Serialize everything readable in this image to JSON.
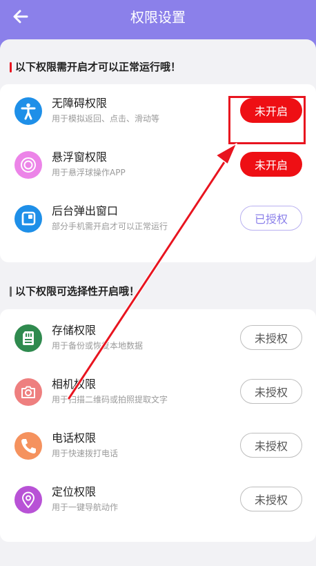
{
  "header": {
    "title": "权限设置",
    "back_icon": "arrow-left-icon",
    "background": "#8b80ea"
  },
  "sections": [
    {
      "title": "以下权限需开启才可以正常运行哦！",
      "accent": "#e8141f",
      "items": [
        {
          "name": "无障碍权限",
          "desc": "用于模拟返回、点击、滑动等",
          "button": "未开启",
          "icon": "accessibility-icon",
          "icon_color": "#1e8fe8"
        },
        {
          "name": "悬浮窗权限",
          "desc": "用于悬浮球操作APP",
          "button": "未开启",
          "icon": "floating-ball-icon",
          "icon_color": "#ec84e8"
        },
        {
          "name": "后台弹出窗口",
          "desc": "部分手机需开启才可以正常运行",
          "button": "已授权",
          "icon": "popup-window-icon",
          "icon_color": "#1e8fe8"
        }
      ]
    },
    {
      "title": "以下权限可选择性开启哦！",
      "accent": "#6b6b6b",
      "items": [
        {
          "name": "存储权限",
          "desc": "用于备份或恢复本地数据",
          "button": "未授权",
          "icon": "sd-card-icon",
          "icon_color": "#2f8a4e"
        },
        {
          "name": "相机权限",
          "desc": "用于扫描二维码或拍照提取文字",
          "button": "未授权",
          "icon": "camera-icon",
          "icon_color": "#ee7f7f"
        },
        {
          "name": "电话权限",
          "desc": "用于快速拨打电话",
          "button": "未授权",
          "icon": "phone-icon",
          "icon_color": "#f5925e"
        },
        {
          "name": "定位权限",
          "desc": "用于一键导航动作",
          "button": "未授权",
          "icon": "location-pin-icon",
          "icon_color": "#b852d6"
        }
      ]
    }
  ],
  "colors": {
    "button_red": "#ee0f14",
    "button_granted": "#8b80ea",
    "annotation_red": "#e8141f"
  }
}
